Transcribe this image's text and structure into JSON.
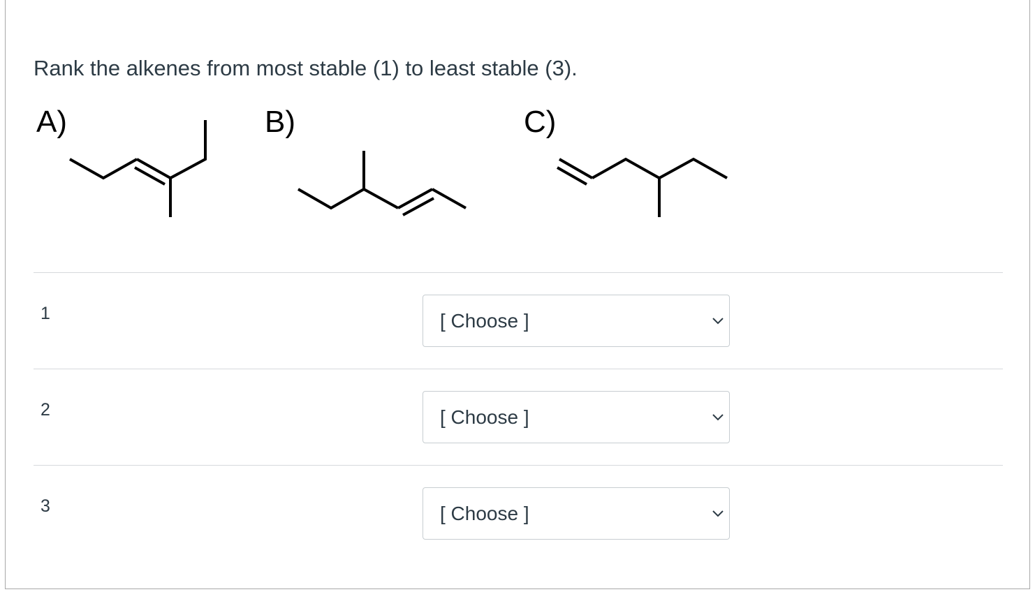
{
  "question": {
    "prompt": "Rank the alkenes from most stable (1) to least stable (3)."
  },
  "structures": [
    {
      "label": "A)"
    },
    {
      "label": "B)"
    },
    {
      "label": "C)"
    }
  ],
  "ranks": [
    {
      "label": "1",
      "selected": "[ Choose ]"
    },
    {
      "label": "2",
      "selected": "[ Choose ]"
    },
    {
      "label": "3",
      "selected": "[ Choose ]"
    }
  ],
  "icons": {
    "dropdown": "chevron-down-icon"
  },
  "colors": {
    "text": "#2d3b45",
    "divider": "#d6d9dc",
    "select_border": "#c7cdd1"
  }
}
